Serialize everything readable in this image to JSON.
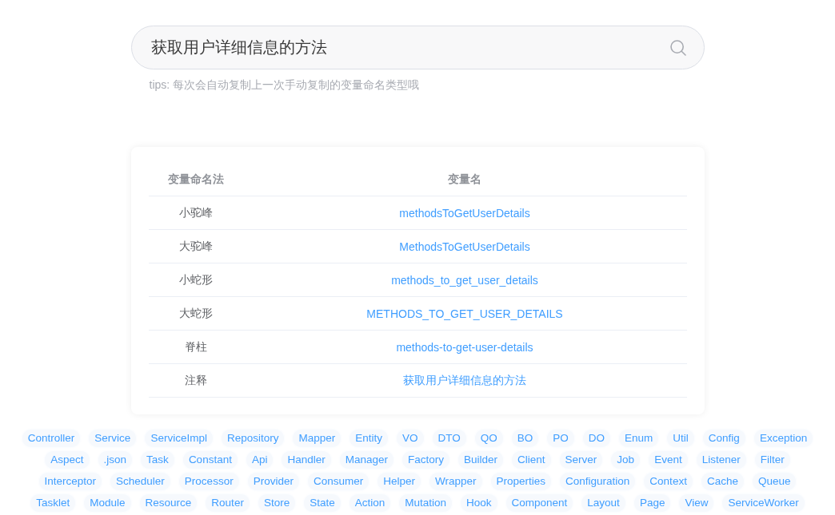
{
  "search": {
    "value": "获取用户详细信息的方法",
    "tip": "tips: 每次会自动复制上一次手动复制的变量命名类型哦"
  },
  "table": {
    "columns": [
      "变量命名法",
      "变量名"
    ],
    "rows": [
      {
        "style": "小驼峰",
        "name": "methodsToGetUserDetails"
      },
      {
        "style": "大驼峰",
        "name": "MethodsToGetUserDetails"
      },
      {
        "style": "小蛇形",
        "name": "methods_to_get_user_details"
      },
      {
        "style": "大蛇形",
        "name": "METHODS_TO_GET_USER_DETAILS"
      },
      {
        "style": "脊柱",
        "name": "methods-to-get-user-details"
      },
      {
        "style": "注释",
        "name": "获取用户详细信息的方法"
      }
    ]
  },
  "suffix_tags": [
    [
      "Controller",
      "Service",
      "ServiceImpl",
      "Repository",
      "Mapper",
      "Entity",
      "VO",
      "DTO",
      "QO",
      "BO",
      "PO",
      "DO",
      "Enum",
      "Util",
      "Config",
      "Exception"
    ],
    [
      "Aspect",
      ".json",
      "Task",
      "Constant",
      "Api",
      "Handler",
      "Manager",
      "Factory",
      "Builder",
      "Client",
      "Server",
      "Job",
      "Event",
      "Listener",
      "Filter"
    ],
    [
      "Interceptor",
      "Scheduler",
      "Processor",
      "Provider",
      "Consumer",
      "Helper",
      "Wrapper",
      "Properties",
      "Configuration",
      "Context",
      "Cache",
      "Queue"
    ],
    [
      "Tasklet",
      "Module",
      "Resource",
      "Router",
      "Store",
      "State",
      "Action",
      "Mutation",
      "Hook",
      "Component",
      "Layout",
      "Page",
      "View",
      "ServiceWorker"
    ]
  ]
}
